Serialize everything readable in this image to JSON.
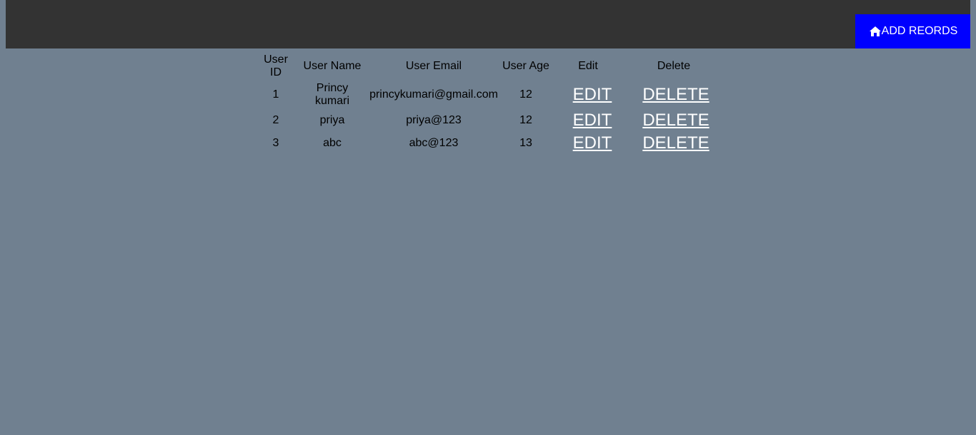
{
  "header": {
    "add_button_label": "ADD REORDS",
    "add_button_icon": "home-icon"
  },
  "table": {
    "columns": [
      "User ID",
      "User Name",
      "User Email",
      "User Age",
      "Edit",
      "Delete"
    ],
    "rows": [
      {
        "id": "1",
        "name": "Princy kumari",
        "email": "princykumari@gmail.com",
        "age": "12",
        "edit": "EDIT",
        "delete": "DELETE"
      },
      {
        "id": "2",
        "name": "priya",
        "email": "priya@123",
        "age": "12",
        "edit": "EDIT",
        "delete": "DELETE"
      },
      {
        "id": "3",
        "name": "abc",
        "email": "abc@123",
        "age": "13",
        "edit": "EDIT",
        "delete": "DELETE"
      }
    ]
  },
  "colors": {
    "page_background": "#708090",
    "topbar_background": "#333333",
    "add_button_background": "#0000ff",
    "link_color": "#ffffff"
  }
}
